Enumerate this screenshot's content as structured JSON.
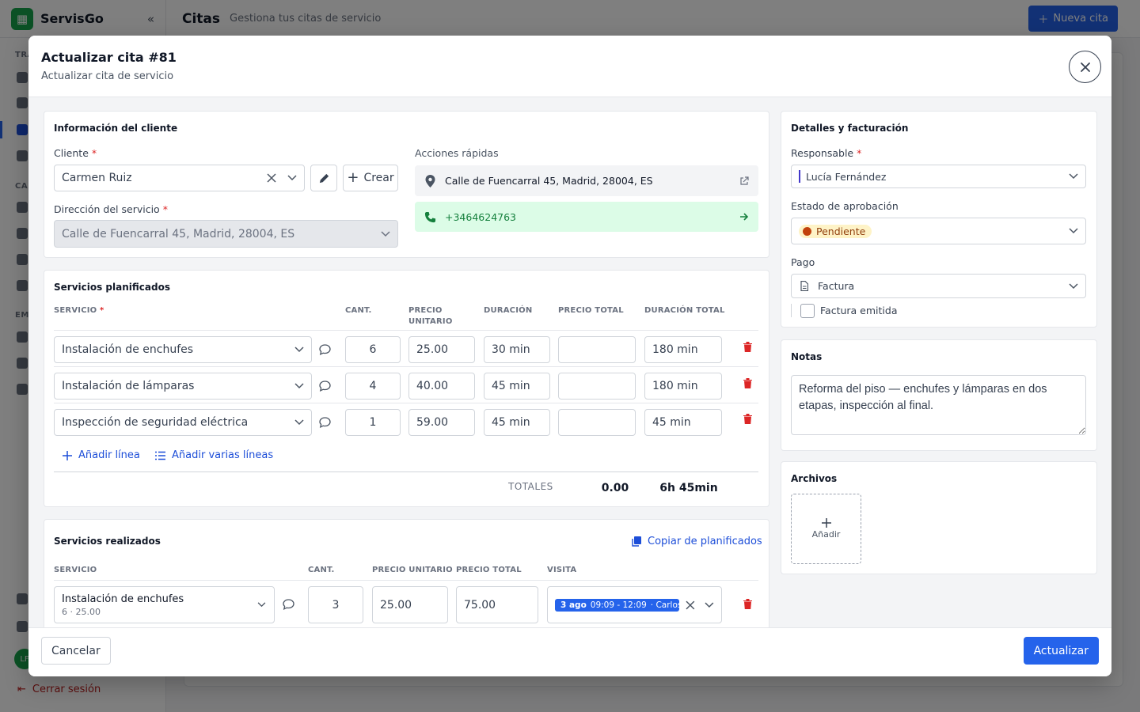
{
  "app": {
    "brand": "ServisGo",
    "sections": [
      "TRA",
      "CA",
      "EM"
    ],
    "logout": "Cerrar sesión",
    "avatar": "LF",
    "header": {
      "title": "Citas",
      "subtitle": "Gestiona tus citas de servicio",
      "new_button": "Nueva cita"
    }
  },
  "modal": {
    "title": "Actualizar cita #81",
    "subtitle": "Actualizar cita de servicio",
    "cancel": "Cancelar",
    "submit": "Actualizar"
  },
  "client_panel": {
    "title": "Información del cliente",
    "client_label": "Cliente",
    "client_value": "Carmen Ruiz",
    "create": "Crear",
    "address_label": "Dirección del servicio",
    "address_value": "Calle de Fuencarral 45, Madrid, 28004, ES",
    "quick_label": "Acciones rápidas",
    "quick_address": "Calle de Fuencarral 45, Madrid, 28004, ES",
    "quick_phone": "+3464624763"
  },
  "planned": {
    "title": "Servicios planificados",
    "columns": {
      "service": "SERVICIO",
      "qty": "CANT.",
      "unit": "PRECIO UNITARIO",
      "duration": "DURACIÓN",
      "total": "PRECIO TOTAL",
      "total_duration": "DURACIÓN TOTAL"
    },
    "rows": [
      {
        "service": "Instalación de enchufes",
        "qty": "6",
        "unit": "25.00",
        "duration": "30 min",
        "total": "",
        "total_duration": "180 min"
      },
      {
        "service": "Instalación de lámparas",
        "qty": "4",
        "unit": "40.00",
        "duration": "45 min",
        "total": "",
        "total_duration": "180 min"
      },
      {
        "service": "Inspección de seguridad eléctrica",
        "qty": "1",
        "unit": "59.00",
        "duration": "45 min",
        "total": "",
        "total_duration": "45 min"
      }
    ],
    "add_line": "Añadir línea",
    "add_lines": "Añadir varias líneas",
    "totals_label": "TOTALES",
    "totals_price": "0.00",
    "totals_duration": "6h 45min"
  },
  "done": {
    "title": "Servicios realizados",
    "copy": "Copiar de planificados",
    "columns": {
      "service": "SERVICIO",
      "qty": "CANT.",
      "unit": "PRECIO UNITARIO",
      "total": "PRECIO TOTAL",
      "visit": "VISITA"
    },
    "rows": [
      {
        "service": "Instalación de enchufes",
        "service_sub": "6 · 25.00",
        "qty": "3",
        "unit": "25.00",
        "total": "75.00",
        "visit_date": "3 ago",
        "visit_time": "09:09 - 12:09",
        "visit_person": "· Carlos G"
      }
    ]
  },
  "billing": {
    "title": "Detalles y facturación",
    "responsible_label": "Responsable",
    "responsible_value": "Lucía Fernández",
    "approval_label": "Estado de aprobación",
    "approval_value": "Pendiente",
    "payment_label": "Pago",
    "payment_value": "Factura",
    "invoice_issued": "Factura emitida"
  },
  "notes": {
    "title": "Notas",
    "value": "Reforma del piso — enchufes y lámparas en dos etapas, inspección al final."
  },
  "files": {
    "title": "Archivos",
    "add": "Añadir"
  },
  "colors": {
    "primary": "#2563eb",
    "success": "#16a34a",
    "danger": "#dc2626",
    "pending": "#fef3c7"
  }
}
